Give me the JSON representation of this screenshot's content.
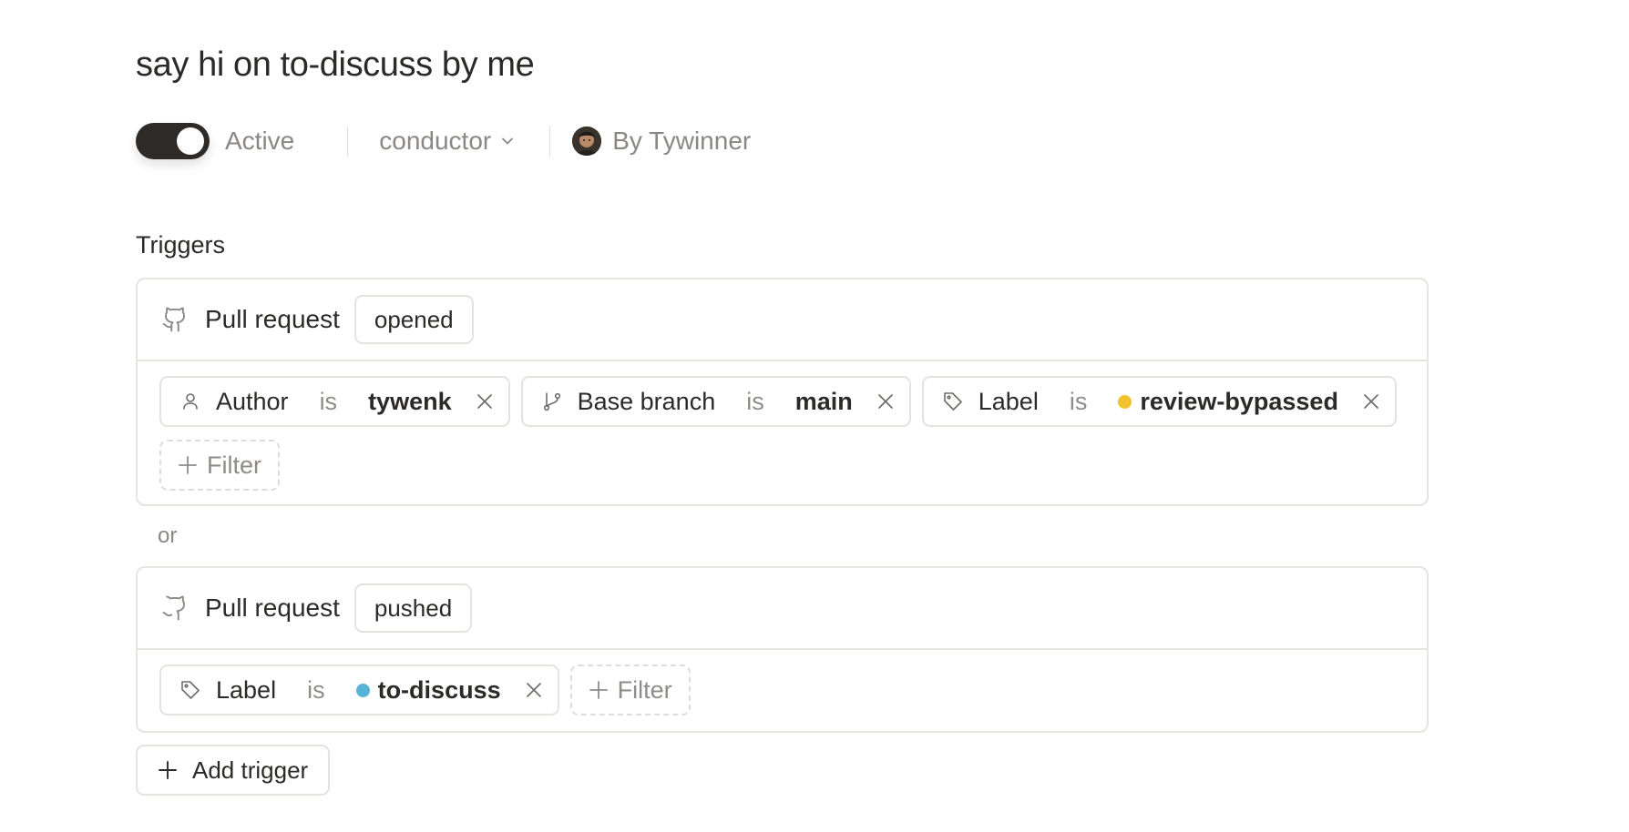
{
  "automation": {
    "title": "say hi on to-discuss by me",
    "status_label": "Active",
    "repository": "conductor",
    "owner": "By Tywinner"
  },
  "triggers": {
    "section_title": "Triggers",
    "separator": "or",
    "add_filter_label": "Filter",
    "add_trigger_label": "Add trigger",
    "items": [
      {
        "type": "Pull request",
        "event": "opened",
        "filters": [
          {
            "icon": "person-icon",
            "field": "Author",
            "operator": "is",
            "value": "tywenk"
          },
          {
            "icon": "git-branch-icon",
            "field": "Base branch",
            "operator": "is",
            "value": "main"
          },
          {
            "icon": "tag-icon",
            "field": "Label",
            "operator": "is",
            "value": "review-bypassed",
            "color": "#f2c12e"
          }
        ]
      },
      {
        "type": "Pull request",
        "event": "pushed",
        "filters": [
          {
            "icon": "tag-icon",
            "field": "Label",
            "operator": "is",
            "value": "to-discuss",
            "color": "#57b3d6"
          }
        ]
      }
    ]
  },
  "colors": {
    "toggle_active": "#2d2a27",
    "border": "#e7e5e2",
    "muted_text": "#8a8784"
  }
}
